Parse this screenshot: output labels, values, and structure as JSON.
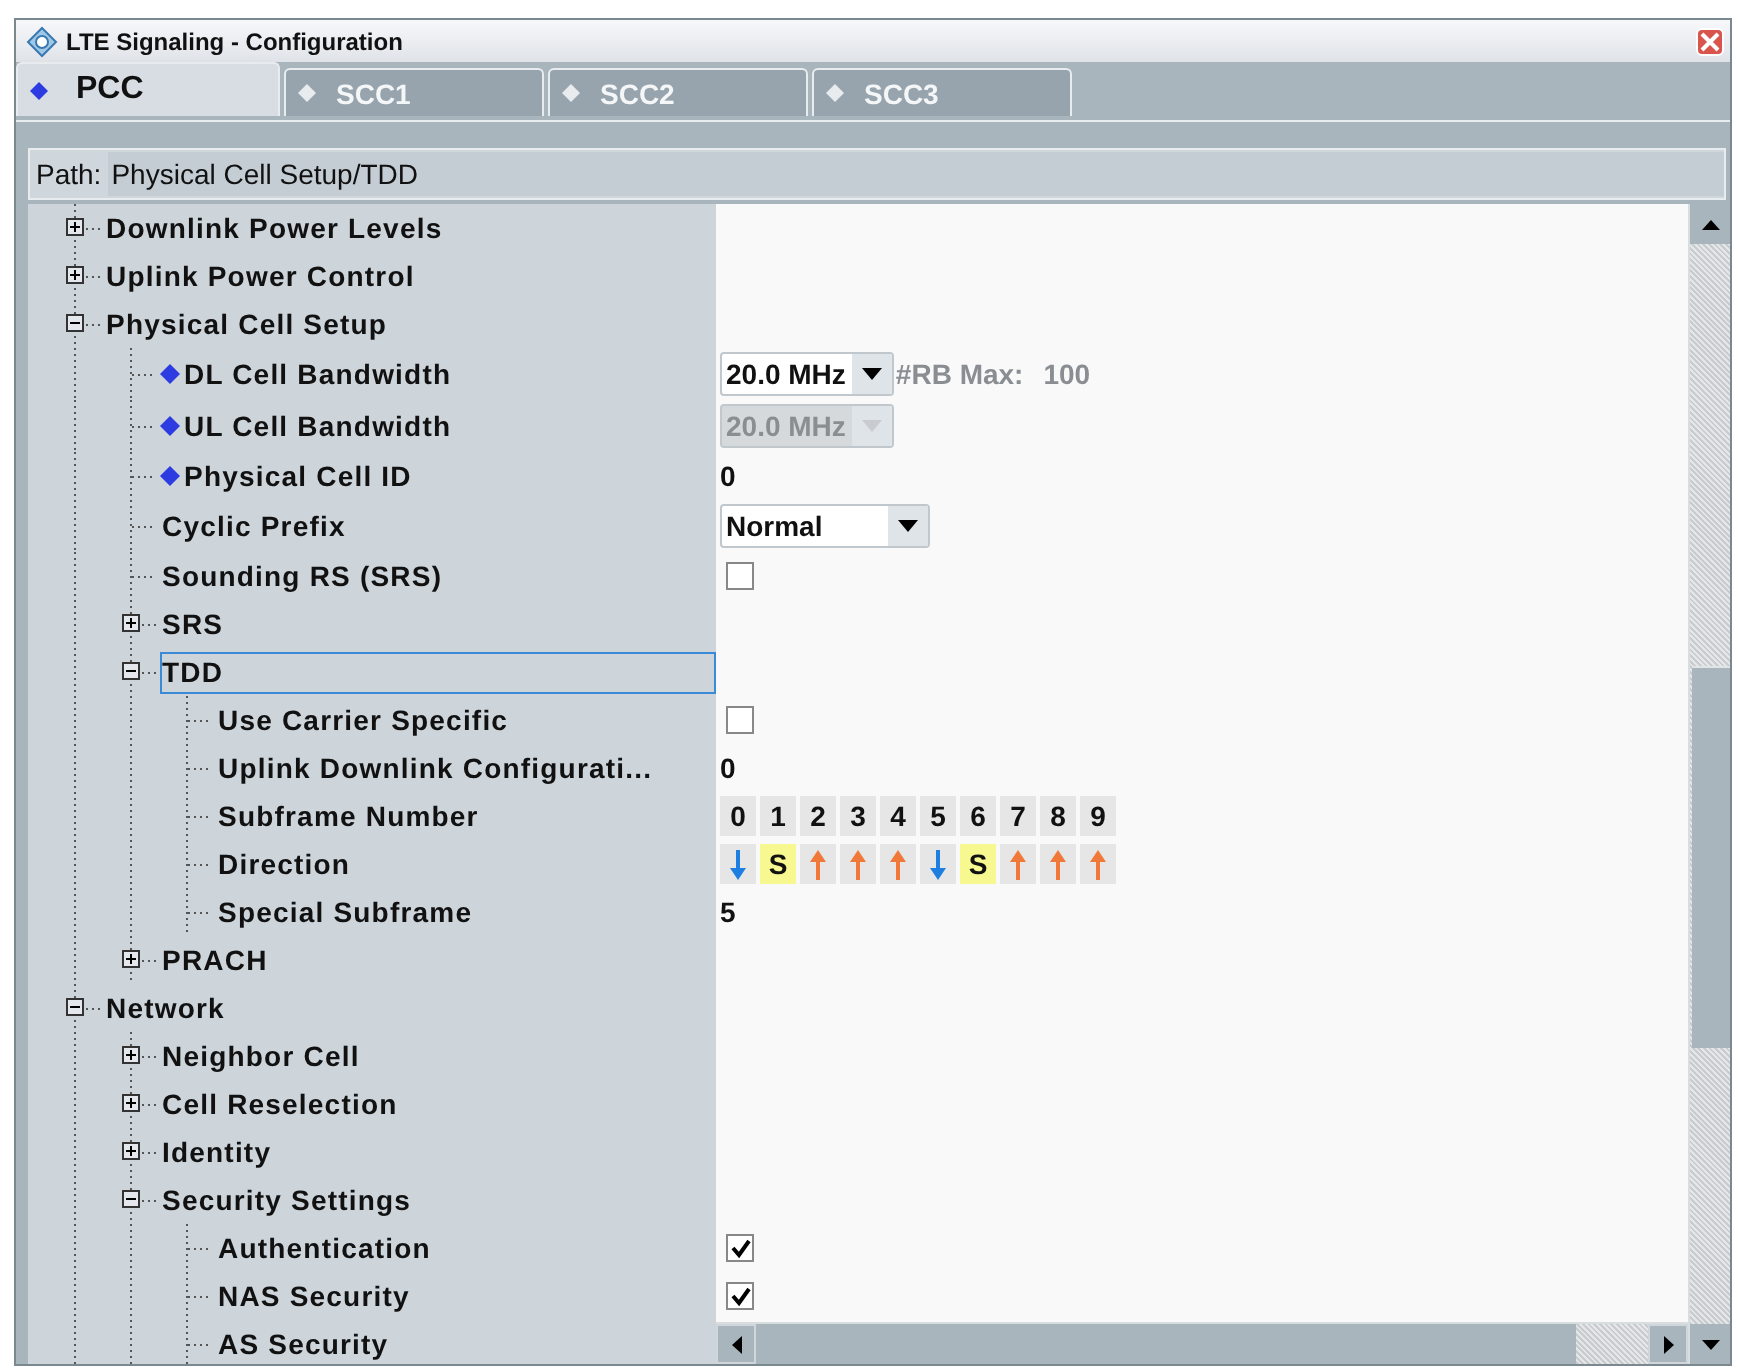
{
  "window": {
    "title": "LTE Signaling  - Configuration"
  },
  "tabs": [
    {
      "label": "PCC",
      "selected": true
    },
    {
      "label": "SCC1",
      "selected": false
    },
    {
      "label": "SCC2",
      "selected": false
    },
    {
      "label": "SCC3",
      "selected": false
    }
  ],
  "path": {
    "label": "Path:",
    "value": "Physical Cell Setup/TDD"
  },
  "tree": [
    {
      "label": "Downlink Power Levels",
      "expanded": false
    },
    {
      "label": "Uplink Power Control",
      "expanded": false
    },
    {
      "label": "Physical Cell Setup",
      "expanded": true,
      "children": [
        {
          "label": "DL Cell Bandwidth",
          "flagged": true,
          "selected": false,
          "value": {
            "kind": "dropdown",
            "text": "20.0 MHz",
            "disabled": false,
            "note": "#RB Max:",
            "note_value": "100"
          }
        },
        {
          "label": "UL Cell Bandwidth",
          "flagged": true,
          "selected": false,
          "value": {
            "kind": "dropdown",
            "text": "20.0 MHz",
            "disabled": true
          }
        },
        {
          "label": "Physical Cell ID",
          "flagged": true,
          "selected": false,
          "value": {
            "kind": "text",
            "text": "0"
          }
        },
        {
          "label": "Cyclic Prefix",
          "flagged": false,
          "selected": false,
          "value": {
            "kind": "dropdown",
            "text": "Normal",
            "disabled": false
          }
        },
        {
          "label": "Sounding RS (SRS)",
          "flagged": false,
          "selected": false,
          "value": {
            "kind": "checkbox",
            "checked": false
          }
        },
        {
          "label": "SRS",
          "flagged": false,
          "selected": false,
          "expanded": false
        },
        {
          "label": "TDD",
          "flagged": false,
          "selected": true,
          "expanded": true,
          "children": [
            {
              "label": "Use Carrier Specific",
              "value": {
                "kind": "checkbox",
                "checked": false
              }
            },
            {
              "label": "Uplink Downlink Configurati...",
              "value": {
                "kind": "text",
                "text": "0"
              }
            },
            {
              "label": "Subframe Number",
              "value": {
                "kind": "numbers",
                "cells": [
                  "0",
                  "1",
                  "2",
                  "3",
                  "4",
                  "5",
                  "6",
                  "7",
                  "8",
                  "9"
                ]
              }
            },
            {
              "label": "Direction",
              "value": {
                "kind": "directions",
                "cells": [
                  {
                    "kind": "down"
                  },
                  {
                    "kind": "special",
                    "text": "S"
                  },
                  {
                    "kind": "up"
                  },
                  {
                    "kind": "up"
                  },
                  {
                    "kind": "up"
                  },
                  {
                    "kind": "down"
                  },
                  {
                    "kind": "special",
                    "text": "S"
                  },
                  {
                    "kind": "up"
                  },
                  {
                    "kind": "up"
                  },
                  {
                    "kind": "up"
                  }
                ]
              }
            },
            {
              "label": "Special Subframe",
              "value": {
                "kind": "text",
                "text": "5"
              }
            }
          ]
        },
        {
          "label": "PRACH",
          "flagged": false,
          "selected": false,
          "expanded": false
        }
      ]
    },
    {
      "label": "Network",
      "expanded": true,
      "children": [
        {
          "label": "Neighbor Cell",
          "expanded": false
        },
        {
          "label": "Cell Reselection",
          "expanded": false
        },
        {
          "label": "Identity",
          "expanded": false
        },
        {
          "label": "Security Settings",
          "expanded": true,
          "children": [
            {
              "label": "Authentication",
              "value": {
                "kind": "checkbox",
                "checked": true
              }
            },
            {
              "label": "NAS Security",
              "value": {
                "kind": "checkbox",
                "checked": true
              }
            },
            {
              "label": "AS Security"
            }
          ]
        }
      ]
    }
  ]
}
